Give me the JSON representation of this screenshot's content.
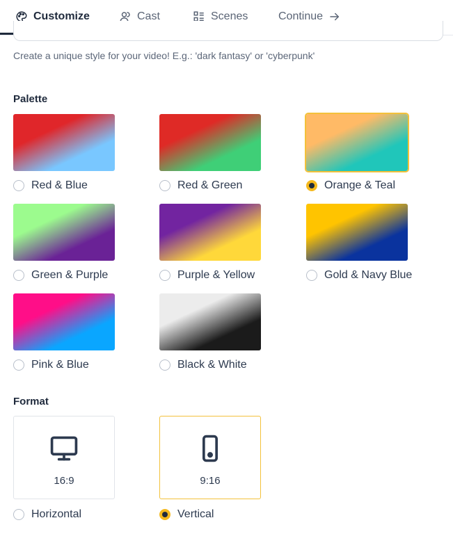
{
  "tabs": [
    {
      "label": "Customize",
      "icon": "palette-icon",
      "active": true
    },
    {
      "label": "Cast",
      "icon": "user-icon",
      "active": false
    },
    {
      "label": "Scenes",
      "icon": "list-icon",
      "active": false
    },
    {
      "label": "Continue",
      "icon": "arrow-right-icon",
      "active": false
    }
  ],
  "style_input": {
    "value": "",
    "placeholder": ""
  },
  "hint": "Create a unique style for your video! E.g.: 'dark fantasy' or 'cyberpunk'",
  "palette": {
    "title": "Palette",
    "selected": "Orange & Teal",
    "options": [
      {
        "label": "Red & Blue",
        "colors": [
          "#e0262a",
          "#79c7ff"
        ]
      },
      {
        "label": "Red & Green",
        "colors": [
          "#df2a26",
          "#3fcf77"
        ]
      },
      {
        "label": "Orange & Teal",
        "colors": [
          "#ffba66",
          "#20c6ba"
        ]
      },
      {
        "label": "Green & Purple",
        "colors": [
          "#9cfb8e",
          "#6a2296"
        ]
      },
      {
        "label": "Purple & Yellow",
        "colors": [
          "#7224a0",
          "#ffd83a"
        ]
      },
      {
        "label": "Gold & Navy Blue",
        "colors": [
          "#ffc400",
          "#0a339e"
        ]
      },
      {
        "label": "Pink & Blue",
        "colors": [
          "#ff0e88",
          "#0aa6ff"
        ]
      },
      {
        "label": "Black & White",
        "colors": [
          "#ececec",
          "#1b1b1b"
        ]
      }
    ]
  },
  "format": {
    "title": "Format",
    "selected": "Vertical",
    "options": [
      {
        "ratio": "16:9",
        "label": "Horizontal",
        "icon": "monitor-icon"
      },
      {
        "ratio": "9:16",
        "label": "Vertical",
        "icon": "phone-icon"
      }
    ]
  },
  "colors": {
    "accent": "#f5b91e",
    "text": "#2d3a4f",
    "border": "#e1e4e9"
  }
}
